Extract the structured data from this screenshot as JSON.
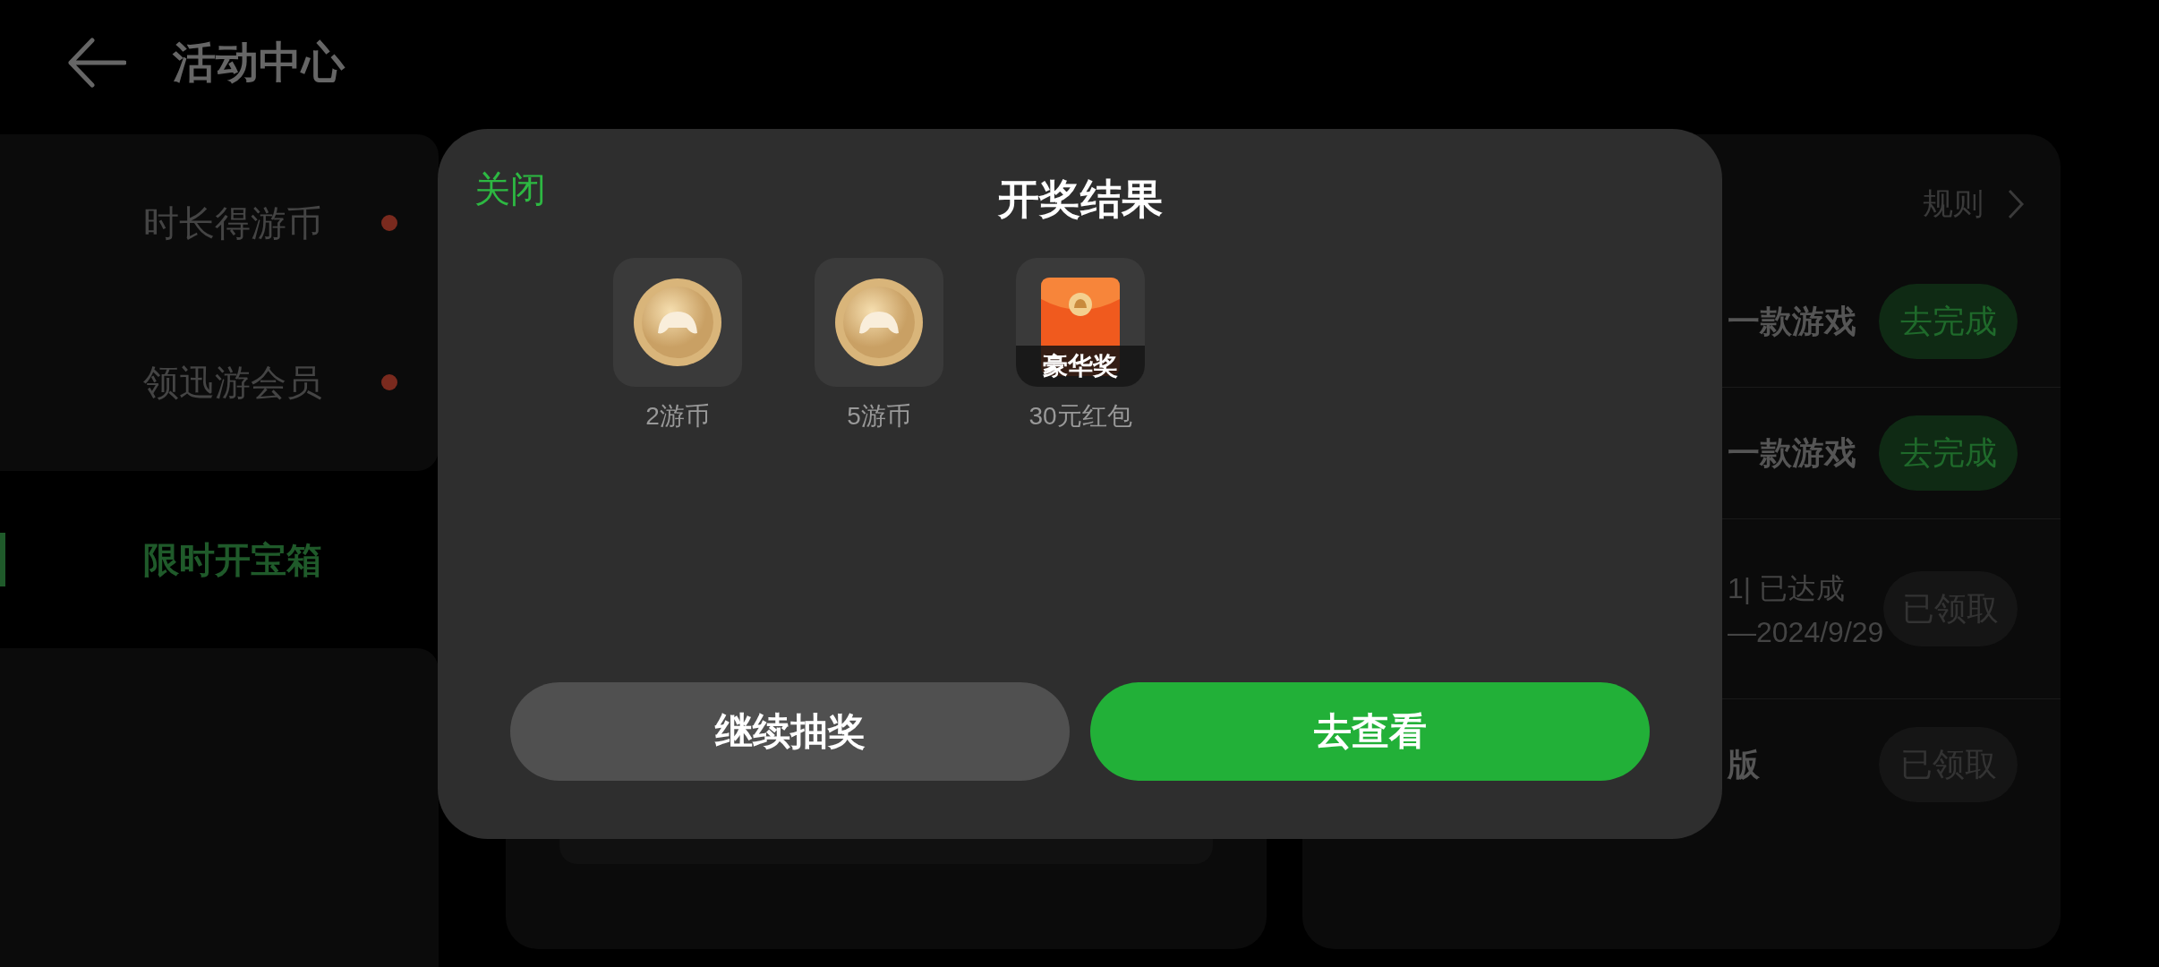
{
  "header": {
    "title": "活动中心"
  },
  "sidebar": {
    "items": [
      {
        "label": "时长得游币",
        "selected": false,
        "badge": true
      },
      {
        "label": "领迅游会员",
        "selected": false,
        "badge": true
      },
      {
        "label": "限时开宝箱",
        "selected": true,
        "badge": false
      }
    ]
  },
  "tasks": {
    "rules_link": "规则",
    "rows": [
      {
        "lines": [
          "一款游戏"
        ],
        "action": "去完成",
        "kind": "todo"
      },
      {
        "lines": [
          "一款游戏"
        ],
        "action": "去完成",
        "kind": "todo"
      },
      {
        "lines": [
          "1| 已达成",
          "—2024/9/29"
        ],
        "action": "已领取",
        "kind": "done"
      },
      {
        "lines": [
          "版"
        ],
        "action": "已领取",
        "kind": "done"
      }
    ]
  },
  "dialog": {
    "close": "关闭",
    "title": "开奖结果",
    "prizes": [
      {
        "label": "2游币",
        "kind": "coin"
      },
      {
        "label": "5游币",
        "kind": "coin"
      },
      {
        "label": "30元红包",
        "kind": "red_envelope",
        "tag": "豪华奖"
      }
    ],
    "buttons": [
      {
        "label": "继续抽奖",
        "kind": "secondary"
      },
      {
        "label": "去查看",
        "kind": "primary"
      }
    ]
  }
}
